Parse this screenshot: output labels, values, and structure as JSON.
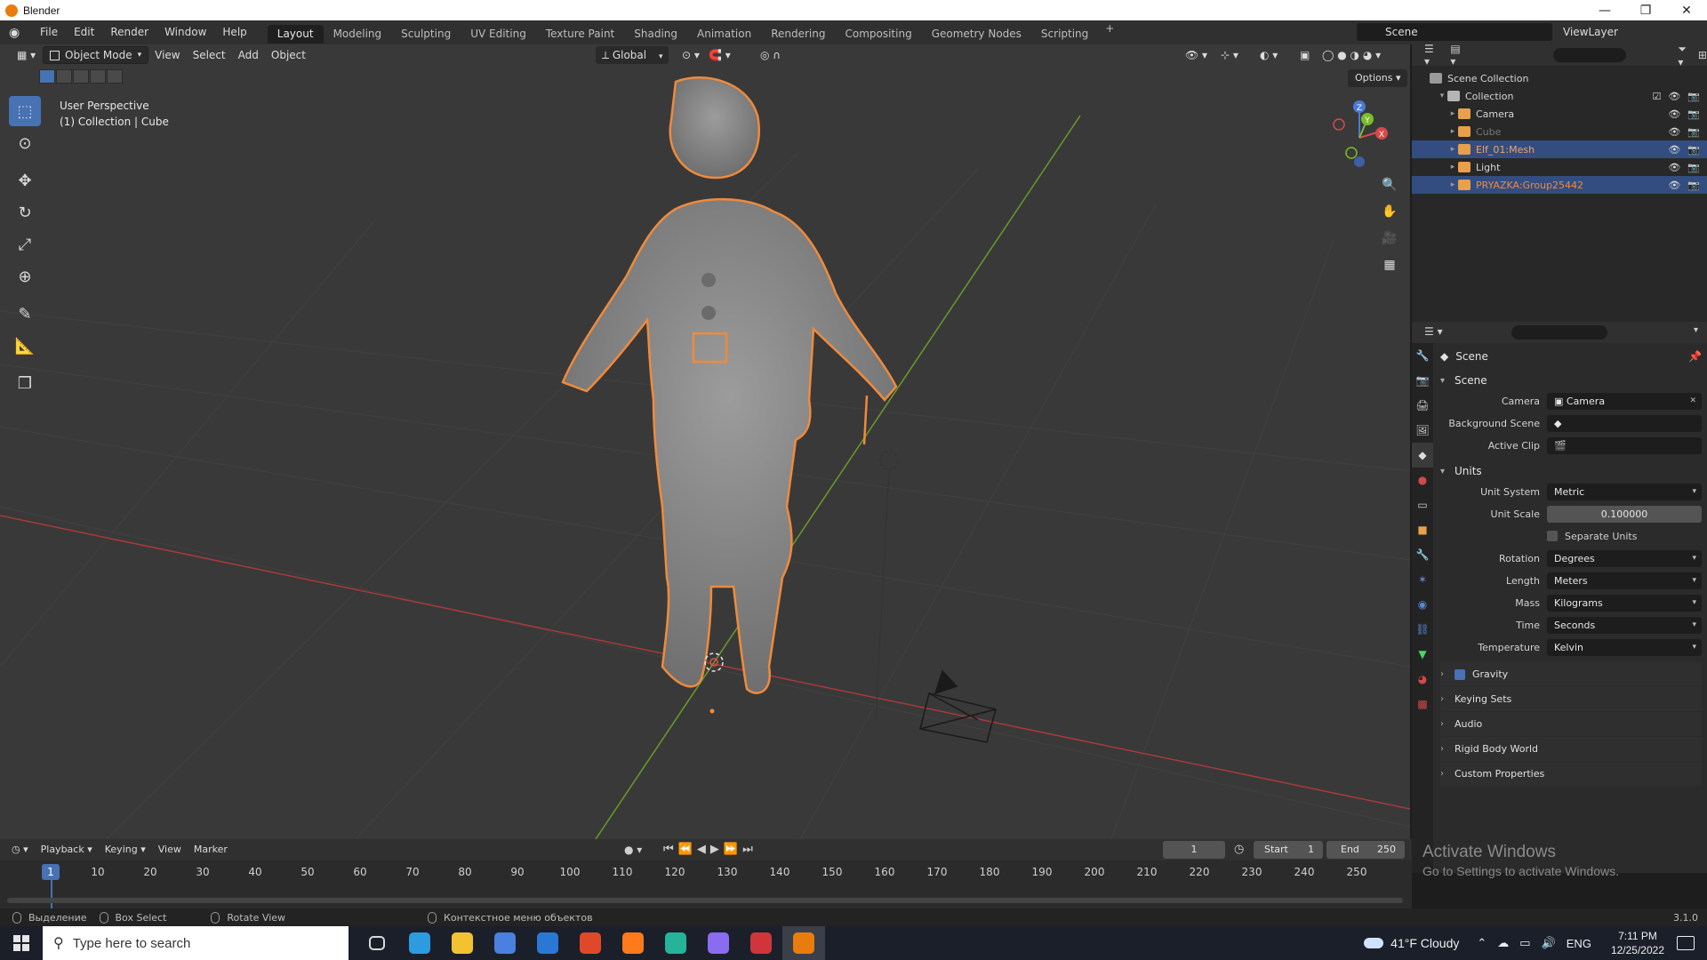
{
  "window": {
    "title": "Blender",
    "controls": [
      "—",
      "❐",
      "✕"
    ]
  },
  "topbar": {
    "menus": [
      "File",
      "Edit",
      "Render",
      "Window",
      "Help"
    ],
    "workspaces": [
      "Layout",
      "Modeling",
      "Sculpting",
      "UV Editing",
      "Texture Paint",
      "Shading",
      "Animation",
      "Rendering",
      "Compositing",
      "Geometry Nodes",
      "Scripting"
    ],
    "active_workspace": "Layout",
    "add_workspace": "+",
    "scene": "Scene",
    "view_layer": "ViewLayer"
  },
  "viewport": {
    "mode": "Object Mode",
    "menus": [
      "View",
      "Select",
      "Add",
      "Object"
    ],
    "orientation": "Global",
    "options": "Options",
    "perspective": "User Perspective",
    "collection_info": "(1) Collection | Cube",
    "gizmo": {
      "x": "X",
      "y": "Y",
      "z": "Z"
    }
  },
  "toolbar": {
    "tools": [
      {
        "name": "select-box-tool",
        "glyph": "⬚",
        "active": true
      },
      {
        "name": "cursor-tool",
        "glyph": "⊙",
        "active": false
      },
      {
        "name": "move-tool",
        "glyph": "✥",
        "active": false
      },
      {
        "name": "rotate-tool",
        "glyph": "↻",
        "active": false
      },
      {
        "name": "scale-tool",
        "glyph": "⤢",
        "active": false
      },
      {
        "name": "transform-tool",
        "glyph": "⊕",
        "active": false
      },
      {
        "name": "annotate-tool",
        "glyph": "✎",
        "active": false
      },
      {
        "name": "measure-tool",
        "glyph": "📐",
        "active": false
      },
      {
        "name": "add-cube-tool",
        "glyph": "❒",
        "active": false
      }
    ],
    "nav": [
      "🔍",
      "✋",
      "🎥",
      "▦"
    ]
  },
  "outliner": {
    "root": "Scene Collection",
    "collection": "Collection",
    "items": [
      {
        "label": "Camera",
        "color": "#e8a04a",
        "selected": false,
        "dim": false
      },
      {
        "label": "Cube",
        "color": "#e8a04a",
        "selected": false,
        "dim": true
      },
      {
        "label": "Elf_01:Mesh",
        "color": "#e8a04a",
        "selected": true,
        "dim": false
      },
      {
        "label": "Light",
        "color": "#e8a04a",
        "selected": false,
        "dim": false
      },
      {
        "label": "PRYAZKA:Group25442",
        "color": "#e8a04a",
        "selected": true,
        "dim": false
      }
    ]
  },
  "properties": {
    "context": "Scene",
    "scene_panel": {
      "title": "Scene",
      "camera_label": "Camera",
      "camera_value": "Camera",
      "bg_label": "Background Scene",
      "clip_label": "Active Clip"
    },
    "units_panel": {
      "title": "Units",
      "rows": [
        {
          "label": "Unit System",
          "value": "Metric",
          "kind": "dropdown"
        },
        {
          "label": "Unit Scale",
          "value": "0.100000",
          "kind": "number"
        }
      ],
      "separate_units": "Separate Units",
      "rows2": [
        {
          "label": "Rotation",
          "value": "Degrees"
        },
        {
          "label": "Length",
          "value": "Meters"
        },
        {
          "label": "Mass",
          "value": "Kilograms"
        },
        {
          "label": "Time",
          "value": "Seconds"
        },
        {
          "label": "Temperature",
          "value": "Kelvin"
        }
      ]
    },
    "collapsed": [
      "Gravity",
      "Keying Sets",
      "Audio",
      "Rigid Body World",
      "Custom Properties"
    ]
  },
  "timeline": {
    "menus": [
      "Playback",
      "Keying",
      "View",
      "Marker"
    ],
    "current_frame": "1",
    "start_label": "Start",
    "start": "1",
    "end_label": "End",
    "end": "250",
    "ticks": [
      "10",
      "20",
      "30",
      "40",
      "50",
      "60",
      "70",
      "80",
      "90",
      "100",
      "110",
      "120",
      "130",
      "140",
      "150",
      "160",
      "170",
      "180",
      "190",
      "200",
      "210",
      "220",
      "230",
      "240",
      "250"
    ]
  },
  "statusbar": {
    "items": [
      "Выделение",
      "Box Select",
      "Rotate View",
      "Контекстное меню объектов"
    ],
    "version": "3.1.0"
  },
  "activate_windows": {
    "line1": "Activate Windows",
    "line2": "Go to Settings to activate Windows."
  },
  "taskbar": {
    "search_placeholder": "Type here to search",
    "apps": [
      {
        "name": "task-view-icon",
        "color": "#d9d9d9"
      },
      {
        "name": "edge-icon",
        "color": "#2d9be0"
      },
      {
        "name": "file-explorer-icon",
        "color": "#f2c230"
      },
      {
        "name": "store-icon",
        "color": "#4b7fe0"
      },
      {
        "name": "mail-icon",
        "color": "#2a78d6"
      },
      {
        "name": "office-icon",
        "color": "#e0482a"
      },
      {
        "name": "firefox-icon",
        "color": "#ff7a1a"
      },
      {
        "name": "app-m-icon",
        "color": "#25b39a"
      },
      {
        "name": "app-drop-icon",
        "color": "#8a6cf0"
      },
      {
        "name": "app-red-icon",
        "color": "#d0353b"
      },
      {
        "name": "blender-icon",
        "color": "#e87d0d"
      }
    ],
    "weather": "41°F  Cloudy",
    "lang": "ENG",
    "time": "7:11 PM",
    "date": "12/25/2022"
  },
  "colors": {
    "accent": "#4772b3",
    "selection": "#f08a3c",
    "x_axis": "#a83a3a",
    "y_axis": "#6a9a2a"
  }
}
